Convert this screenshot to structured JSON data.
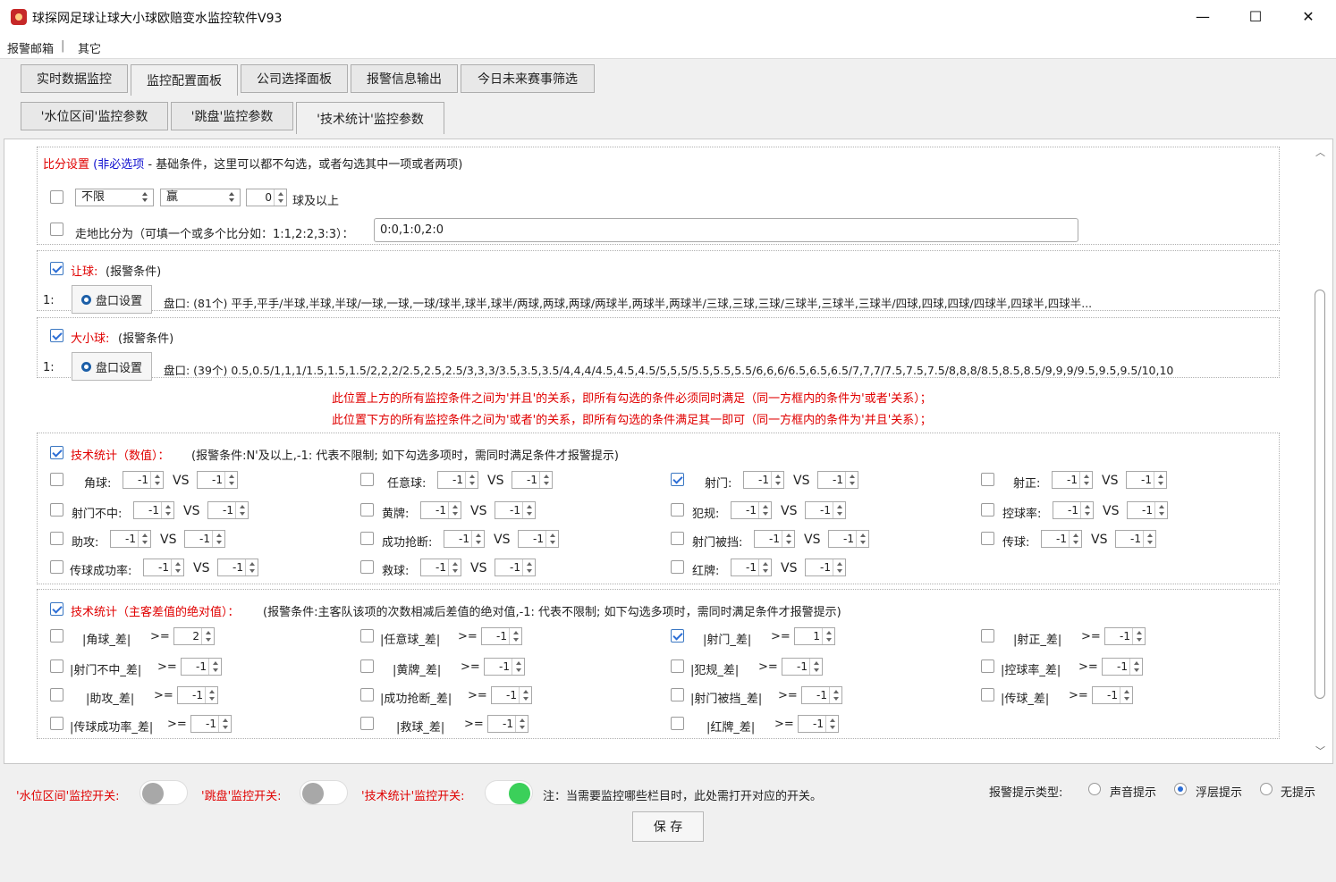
{
  "window": {
    "title": "球探网足球让球大小球欧赔变水监控软件V93",
    "min": "—",
    "max": "☐",
    "close": "✕"
  },
  "menu": [
    "报警邮箱",
    "|",
    "其它"
  ],
  "tabs": [
    "实时数据监控",
    "监控配置面板",
    "公司选择面板",
    "报警信息输出",
    "今日未来赛事筛选"
  ],
  "subtabs": [
    "'水位区间'监控参数",
    "'跳盘'监控参数",
    "'技术统计'监控参数"
  ],
  "score": {
    "title": "比分设置",
    "optional": "(非必选项",
    "desc": "- 基础条件，这里可以都不勾选，或者勾选其中一项或者两项)",
    "combo1": "不限",
    "combo2": "赢",
    "spin": "0",
    "suffix": "球及以上",
    "walk_label": "走地比分为（可填一个或多个比分如：1:1,2:2,3:3）：",
    "walk_value": "0:0,1:0,2:0"
  },
  "handicap": {
    "label": "让球:",
    "note": "(报警条件)",
    "row_no": "1:",
    "btn": "盘口设置",
    "text": "盘口: (81个) 平手,平手/半球,半球,半球/一球,一球,一球/球半,球半,球半/两球,两球,两球/两球半,两球半,两球半/三球,三球,三球/三球半,三球半,三球半/四球,四球,四球/四球半,四球半,四球半..."
  },
  "overunder": {
    "label": "大小球:",
    "note": "(报警条件)",
    "row_no": "1:",
    "btn": "盘口设置",
    "text": "盘口: (39个) 0.5,0.5/1,1,1/1.5,1.5,1.5/2,2,2/2.5,2.5,2.5/3,3,3/3.5,3.5,3.5/4,4,4/4.5,4.5,4.5/5,5,5/5.5,5.5,5.5/6,6,6/6.5,6.5,6.5/7,7,7/7.5,7.5,7.5/8,8,8/8.5,8.5,8.5/9,9,9/9.5,9.5,9.5/10,10"
  },
  "notes": [
    "此位置上方的所有监控条件之间为'并且'的关系，即所有勾选的条件必须同时满足（同一方框内的条件为'或者'关系）；",
    "此位置下方的所有监控条件之间为'或者'的关系，即所有勾选的条件满足其一即可（同一方框内的条件为'并且'关系）；"
  ],
  "tech": {
    "title": "技术统计（数值）：",
    "desc": "(报警条件:N'及以上,-1: 代表不限制; 如下勾选多项时，需同时满足条件才报警提示)",
    "vs": "VS",
    "items": [
      {
        "label": "角球:",
        "a": "-1",
        "b": "-1",
        "checked": false
      },
      {
        "label": "任意球:",
        "a": "-1",
        "b": "-1",
        "checked": false
      },
      {
        "label": "射门:",
        "a": "-1",
        "b": "-1",
        "checked": true
      },
      {
        "label": "射正:",
        "a": "-1",
        "b": "-1",
        "checked": false
      },
      {
        "label": "射门不中:",
        "a": "-1",
        "b": "-1",
        "checked": false
      },
      {
        "label": "黄牌:",
        "a": "-1",
        "b": "-1",
        "checked": false
      },
      {
        "label": "犯规:",
        "a": "-1",
        "b": "-1",
        "checked": false
      },
      {
        "label": "控球率:",
        "a": "-1",
        "b": "-1",
        "checked": false
      },
      {
        "label": "助攻:",
        "a": "-1",
        "b": "-1",
        "checked": false
      },
      {
        "label": "成功抢断:",
        "a": "-1",
        "b": "-1",
        "checked": false
      },
      {
        "label": "射门被挡:",
        "a": "-1",
        "b": "-1",
        "checked": false
      },
      {
        "label": "传球:",
        "a": "-1",
        "b": "-1",
        "checked": false
      },
      {
        "label": "传球成功率:",
        "a": "-1",
        "b": "-1",
        "checked": false
      },
      {
        "label": "救球:",
        "a": "-1",
        "b": "-1",
        "checked": false
      },
      {
        "label": "红牌:",
        "a": "-1",
        "b": "-1",
        "checked": false
      }
    ]
  },
  "diff": {
    "title": "技术统计（主客差值的绝对值）：",
    "desc": "(报警条件:主客队该项的次数相减后差值的绝对值,-1: 代表不限制; 如下勾选多项时，需同时满足条件才报警提示)",
    "ge": ">=",
    "items": [
      {
        "label": "|角球_差|",
        "v": "2",
        "checked": false
      },
      {
        "label": "|任意球_差|",
        "v": "-1",
        "checked": false
      },
      {
        "label": "|射门_差|",
        "v": "1",
        "checked": true
      },
      {
        "label": "|射正_差|",
        "v": "-1",
        "checked": false
      },
      {
        "label": "|射门不中_差|",
        "v": "-1",
        "checked": false
      },
      {
        "label": "|黄牌_差|",
        "v": "-1",
        "checked": false
      },
      {
        "label": "|犯规_差|",
        "v": "-1",
        "checked": false
      },
      {
        "label": "|控球率_差|",
        "v": "-1",
        "checked": false
      },
      {
        "label": "|助攻_差|",
        "v": "-1",
        "checked": false
      },
      {
        "label": "|成功抢断_差|",
        "v": "-1",
        "checked": false
      },
      {
        "label": "|射门被挡_差|",
        "v": "-1",
        "checked": false
      },
      {
        "label": "|传球_差|",
        "v": "-1",
        "checked": false
      },
      {
        "label": "|传球成功率_差|",
        "v": "-1",
        "checked": false
      },
      {
        "label": "|救球_差|",
        "v": "-1",
        "checked": false
      },
      {
        "label": "|红牌_差|",
        "v": "-1",
        "checked": false
      }
    ]
  },
  "bottom": {
    "sw1": "'水位区间'监控开关:",
    "sw2": "'跳盘'监控开关:",
    "sw3": "'技术统计'监控开关:",
    "note": "注：当需要监控哪些栏目时，此处需打开对应的开关。",
    "alert_type": "报警提示类型:",
    "r1": "声音提示",
    "r2": "浮层提示",
    "r3": "无提示",
    "save": "保 存"
  }
}
